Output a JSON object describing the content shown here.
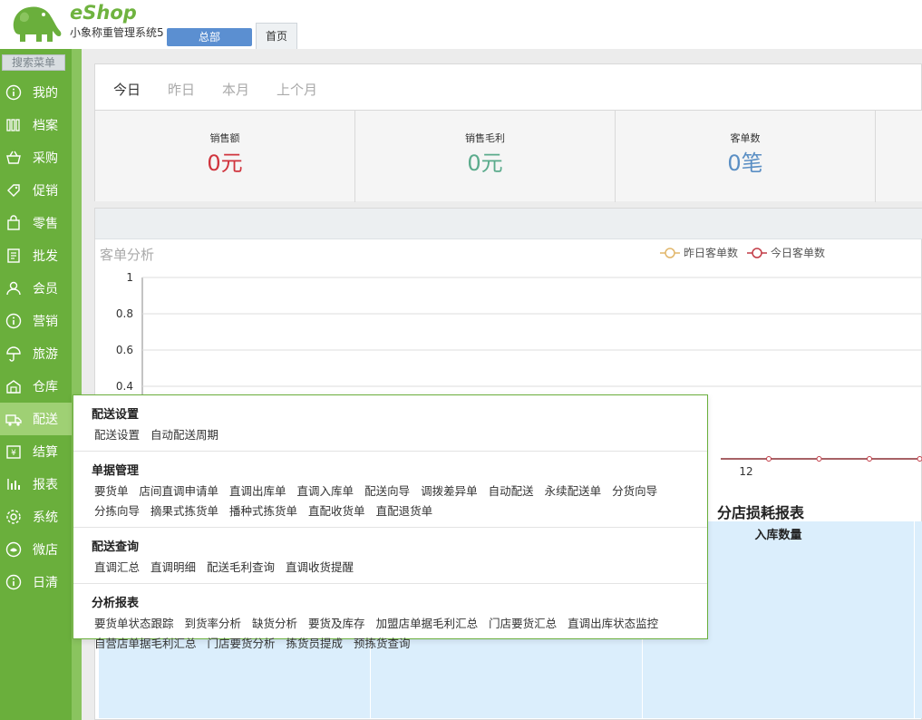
{
  "header": {
    "brand": "eShop",
    "subtitle": "小象称重管理系统5",
    "branch_button": "总部",
    "home_tab": "首页"
  },
  "sidebar": {
    "search_label": "搜索菜单",
    "items": [
      {
        "label": "我的",
        "icon": "info-icon"
      },
      {
        "label": "档案",
        "icon": "books-icon"
      },
      {
        "label": "采购",
        "icon": "basket-icon"
      },
      {
        "label": "促销",
        "icon": "tag-icon"
      },
      {
        "label": "零售",
        "icon": "bag-icon"
      },
      {
        "label": "批发",
        "icon": "receipt-icon"
      },
      {
        "label": "会员",
        "icon": "user-icon"
      },
      {
        "label": "营销",
        "icon": "info-icon"
      },
      {
        "label": "旅游",
        "icon": "umbrella-icon"
      },
      {
        "label": "仓库",
        "icon": "warehouse-icon"
      },
      {
        "label": "配送",
        "icon": "truck-icon",
        "active": true
      },
      {
        "label": "结算",
        "icon": "settle-icon"
      },
      {
        "label": "报表",
        "icon": "bar-chart-icon"
      },
      {
        "label": "系统",
        "icon": "gear-icon"
      },
      {
        "label": "微店",
        "icon": "shop-icon"
      },
      {
        "label": "日清",
        "icon": "info-icon"
      }
    ]
  },
  "dashboard": {
    "date_tabs": [
      "今日",
      "昨日",
      "本月",
      "上个月"
    ],
    "stats": [
      {
        "label": "销售额",
        "value": "0元",
        "color": "#d0343d"
      },
      {
        "label": "销售毛利",
        "value": "0元",
        "color": "#5bab8c"
      },
      {
        "label": "客单数",
        "value": "0笔",
        "color": "#5b8fc4"
      }
    ]
  },
  "chart": {
    "title": "客单分析",
    "legend": [
      {
        "label": "昨日客单数",
        "color": "#e1b66a"
      },
      {
        "label": "今日客单数",
        "color": "#c23b46"
      }
    ]
  },
  "chart_data": {
    "type": "line",
    "title": "客单分析",
    "ylim": [
      0,
      1
    ],
    "y_ticks": [
      "1",
      "0.8",
      "0.6",
      "0.4"
    ],
    "x_tick_visible": "12",
    "series": [
      {
        "name": "昨日客单数",
        "values": [
          0,
          0,
          0,
          0,
          0,
          0,
          0
        ]
      },
      {
        "name": "今日客单数",
        "values": [
          0,
          0,
          0,
          0,
          0,
          0,
          0
        ]
      }
    ],
    "grid": true,
    "legend": "top"
  },
  "report": {
    "title": "分店损耗报表",
    "visible_header": "入库数量"
  },
  "flyout": {
    "sections": [
      {
        "title": "配送设置",
        "links": [
          "配送设置",
          "自动配送周期"
        ]
      },
      {
        "title": "单据管理",
        "links": [
          "要货单",
          "店间直调申请单",
          "直调出库单",
          "直调入库单",
          "配送向导",
          "调拨差异单",
          "自动配送",
          "永续配送单",
          "分货向导",
          "分拣向导",
          "摘果式拣货单",
          "播种式拣货单",
          "直配收货单",
          "直配退货单"
        ]
      },
      {
        "title": "配送查询",
        "links": [
          "直调汇总",
          "直调明细",
          "配送毛利查询",
          "直调收货提醒"
        ]
      },
      {
        "title": "分析报表",
        "links": [
          "要货单状态跟踪",
          "到货率分析",
          "缺货分析",
          "要货及库存",
          "加盟店单据毛利汇总",
          "门店要货汇总",
          "直调出库状态监控",
          "自营店单据毛利汇总",
          "门店要货分析",
          "拣货员提成",
          "预拣货查询"
        ]
      }
    ]
  }
}
